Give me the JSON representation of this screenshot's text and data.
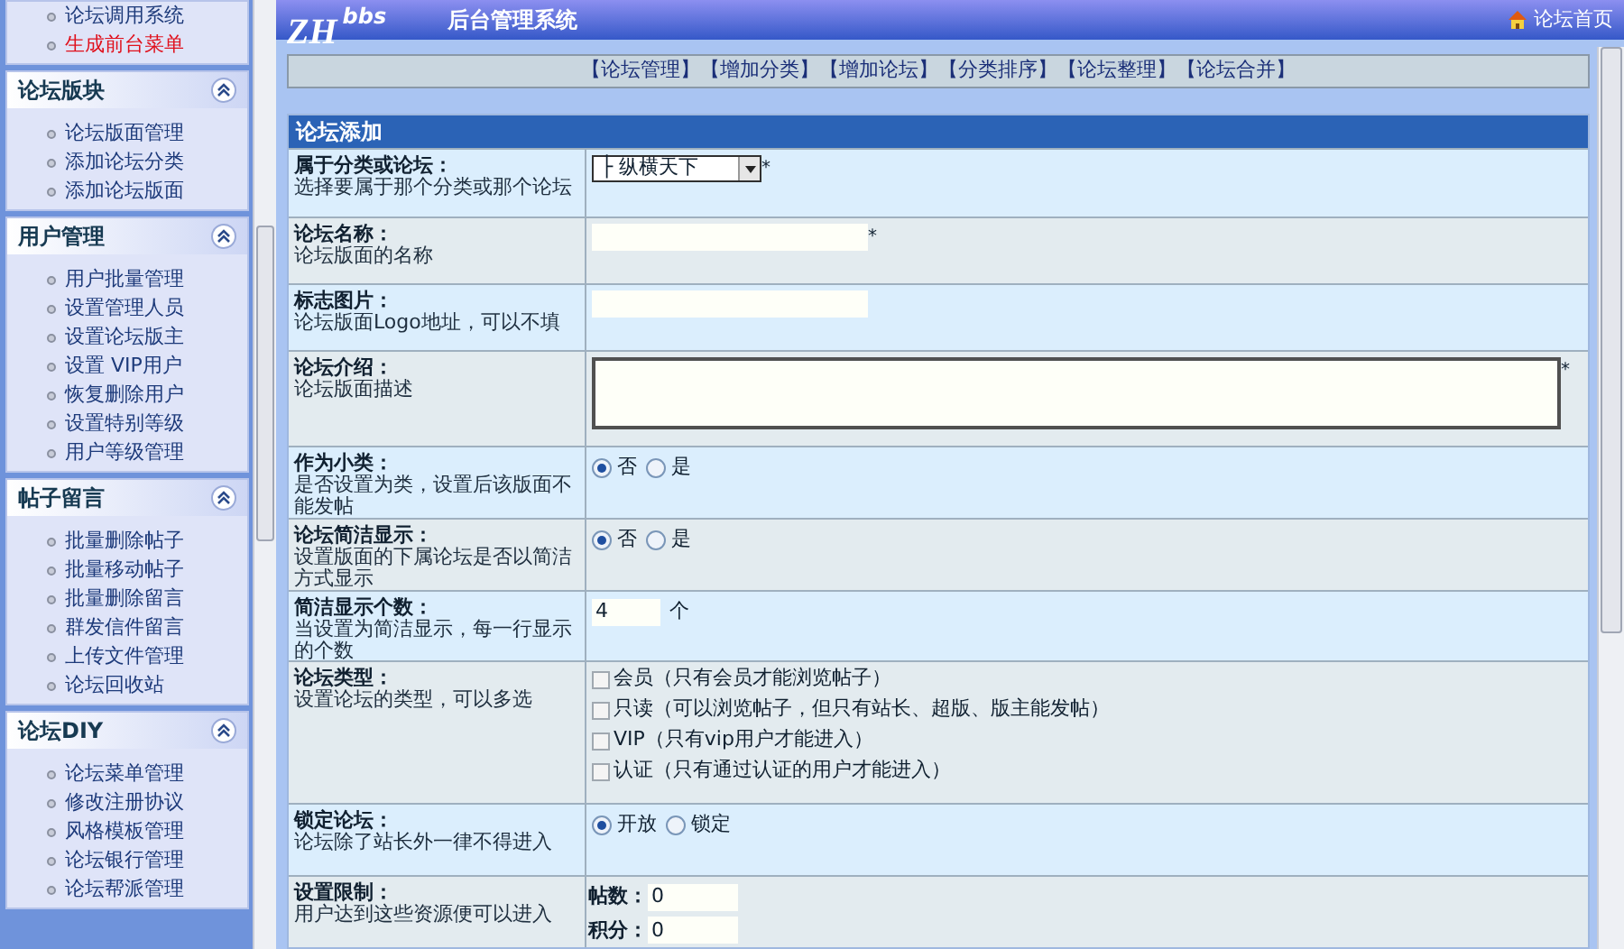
{
  "sidebar": {
    "sections": [
      {
        "items": [
          {
            "label": "论坛调用系统",
            "kind": "normal"
          },
          {
            "label": "生成前台菜单",
            "kind": "highlight"
          }
        ]
      },
      {
        "title": "论坛版块",
        "expanded": true,
        "items": [
          {
            "label": "论坛版面管理",
            "kind": "normal"
          },
          {
            "label": "添加论坛分类",
            "kind": "normal"
          },
          {
            "label": "添加论坛版面",
            "kind": "normal"
          }
        ]
      },
      {
        "title": "用户管理",
        "expanded": true,
        "items": [
          {
            "label": "用户批量管理",
            "kind": "normal"
          },
          {
            "label": "设置管理人员",
            "kind": "normal"
          },
          {
            "label": "设置论坛版主",
            "kind": "normal"
          },
          {
            "label": "设置 VIP用户",
            "kind": "normal"
          },
          {
            "label": "恢复删除用户",
            "kind": "normal"
          },
          {
            "label": "设置特别等级",
            "kind": "normal"
          },
          {
            "label": "用户等级管理",
            "kind": "normal"
          }
        ]
      },
      {
        "title": "帖子留言",
        "expanded": true,
        "items": [
          {
            "label": "批量删除帖子",
            "kind": "normal"
          },
          {
            "label": "批量移动帖子",
            "kind": "normal"
          },
          {
            "label": "批量删除留言",
            "kind": "normal"
          },
          {
            "label": "群发信件留言",
            "kind": "normal"
          },
          {
            "label": "上传文件管理",
            "kind": "normal"
          },
          {
            "label": "论坛回收站",
            "kind": "normal"
          }
        ]
      },
      {
        "title": "论坛DIY",
        "expanded": true,
        "items": [
          {
            "label": "论坛菜单管理",
            "kind": "normal"
          },
          {
            "label": "修改注册协议",
            "kind": "normal"
          },
          {
            "label": "风格模板管理",
            "kind": "normal"
          },
          {
            "label": "论坛银行管理",
            "kind": "normal"
          },
          {
            "label": "论坛帮派管理",
            "kind": "normal"
          }
        ]
      }
    ]
  },
  "header": {
    "logo": "ZH",
    "logo_sub": "bbs",
    "title": "后台管理系统",
    "home_link": "论坛首页"
  },
  "nav_links": [
    "【论坛管理】",
    "【增加分类】",
    "【增加论坛】",
    "【分类排序】",
    "【论坛整理】",
    "【论坛合并】"
  ],
  "form": {
    "title": "论坛添加",
    "rows": [
      {
        "label": "属于分类或论坛：",
        "hint": "选择要属于那个分类或那个论坛",
        "kind": "select",
        "value": "├ 纵横天下",
        "mark": "*"
      },
      {
        "label": "论坛名称：",
        "hint": "论坛版面的名称",
        "kind": "text",
        "value": "",
        "mark": "*"
      },
      {
        "label": "标志图片：",
        "hint": "论坛版面Logo地址，可以不填",
        "kind": "text",
        "value": ""
      },
      {
        "label": "论坛介绍：",
        "hint": "论坛版面描述",
        "kind": "textarea",
        "value": "",
        "mark": "*"
      },
      {
        "label": "作为小类：",
        "hint": "是否设置为类，设置后该版面不能发帖",
        "kind": "radio",
        "options": [
          {
            "label": "否",
            "selected": true
          },
          {
            "label": "是",
            "selected": false
          }
        ]
      },
      {
        "label": "论坛简洁显示：",
        "hint": "设置版面的下属论坛是否以简洁方式显示",
        "kind": "radio",
        "options": [
          {
            "label": "否",
            "selected": true
          },
          {
            "label": "是",
            "selected": false
          }
        ]
      },
      {
        "label": "简洁显示个数：",
        "hint": "当设置为简洁显示，每一行显示的个数",
        "kind": "number",
        "value": "4",
        "unit": "个"
      },
      {
        "label": "论坛类型：",
        "hint": "设置论坛的类型，可以多选",
        "kind": "checkboxes",
        "options": [
          {
            "label": "会员（只有会员才能浏览帖子）",
            "checked": false
          },
          {
            "label": "只读（可以浏览帖子，但只有站长、超版、版主能发帖）",
            "checked": false
          },
          {
            "label": "VIP（只有vip用户才能进入）",
            "checked": false
          },
          {
            "label": "认证（只有通过认证的用户才能进入）",
            "checked": false
          }
        ]
      },
      {
        "label": "锁定论坛：",
        "hint": "论坛除了站长外一律不得进入",
        "kind": "radio",
        "options": [
          {
            "label": "开放",
            "selected": true
          },
          {
            "label": "锁定",
            "selected": false
          }
        ]
      },
      {
        "label": "设置限制：",
        "hint": "用户达到这些资源便可以进入",
        "kind": "limits",
        "fields": [
          {
            "label": "帖数：",
            "value": "0"
          },
          {
            "label": "积分：",
            "value": "0"
          }
        ]
      }
    ]
  }
}
